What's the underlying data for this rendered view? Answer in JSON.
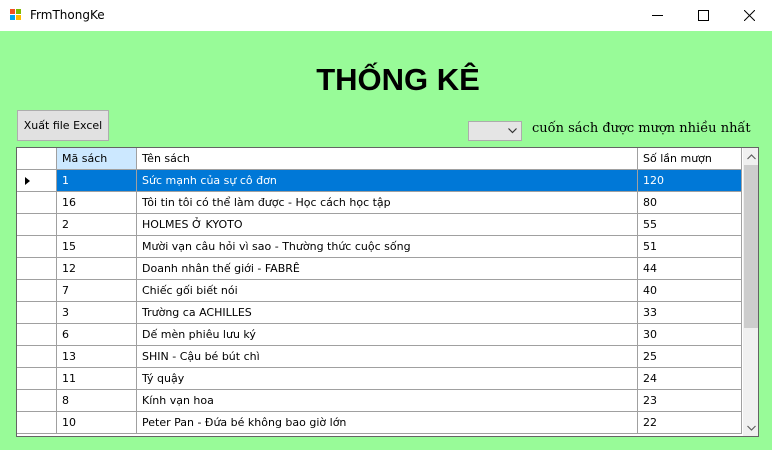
{
  "window": {
    "title": "FrmThongKe"
  },
  "heading": "THỐNG KÊ",
  "export_button": "Xuất file Excel",
  "top_combo": {
    "selected": ""
  },
  "top_label": "cuốn sách được mượn nhiều nhất",
  "table": {
    "columns": [
      "Mã sách",
      "Tên sách",
      "Số lần mượn"
    ],
    "rows": [
      [
        "1",
        "Sức mạnh của sự cô đơn",
        "120"
      ],
      [
        "16",
        "Tôi tin tôi có thể làm được - Học cách học tập",
        "80"
      ],
      [
        "2",
        "HOLMES Ở KYOTO",
        "55"
      ],
      [
        "15",
        "Mười vạn câu hỏi vì sao - Thường thức cuộc sống",
        "51"
      ],
      [
        "12",
        "Doanh nhân thế giới - FABRÊ",
        "44"
      ],
      [
        "7",
        "Chiếc gối biết nói",
        "40"
      ],
      [
        "3",
        "Trường ca ACHILLES",
        "33"
      ],
      [
        "6",
        "Dế mèn phiêu lưu ký",
        "30"
      ],
      [
        "13",
        "SHIN - Cậu bé bút chì",
        "25"
      ],
      [
        "11",
        "Tý quậy",
        "24"
      ],
      [
        "8",
        "Kính vạn hoa",
        "23"
      ],
      [
        "10",
        "Peter Pan - Đứa bé không bao giờ lớn",
        "22"
      ]
    ],
    "selected_row": 0
  },
  "colors": {
    "background": "#98fb98",
    "selection": "#0078d7",
    "header_active": "#cce8ff"
  },
  "icons": [
    "app-icon",
    "minimize-icon",
    "maximize-icon",
    "close-icon",
    "dropdown-arrow-icon",
    "scroll-up-icon",
    "scroll-down-icon",
    "row-selector-icon"
  ]
}
